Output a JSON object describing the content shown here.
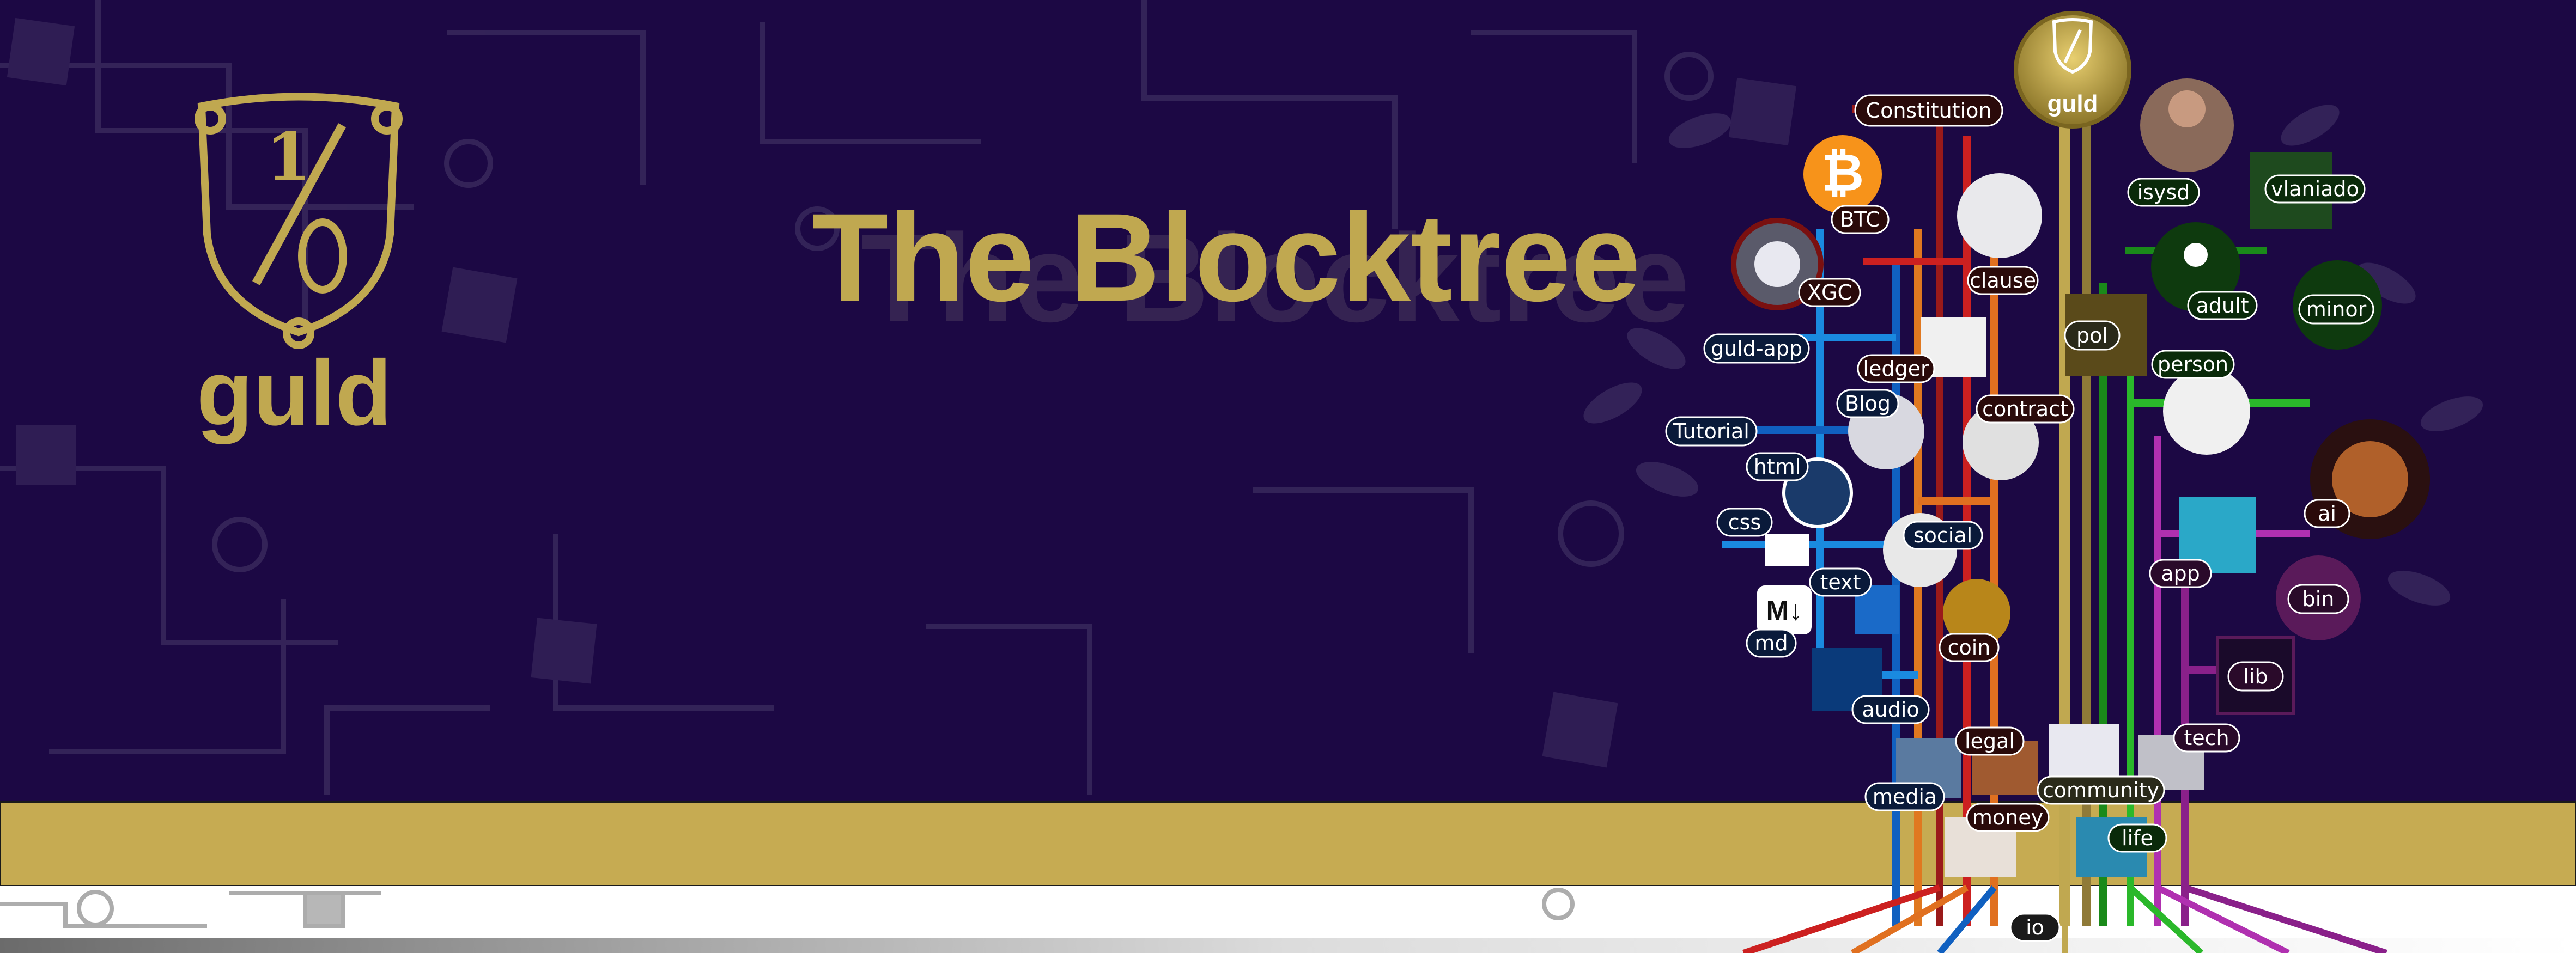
{
  "logo": {
    "text": "guld"
  },
  "title": {
    "text": "The Blocktree"
  },
  "tree": {
    "root_label": "guld",
    "nodes": [
      "Constitution",
      "BTC",
      "XGC",
      "clause",
      "isysd",
      "vlaniado",
      "guld-app",
      "ledger",
      "pol",
      "adult",
      "minor",
      "Blog",
      "contract",
      "person",
      "Tutorial",
      "html",
      "css",
      "social",
      "ai",
      "app",
      "text",
      "bin",
      "md",
      "coin",
      "lib",
      "audio",
      "tech",
      "legal",
      "media",
      "community",
      "money",
      "life",
      "io"
    ]
  },
  "colors": {
    "background": "#1c0844",
    "gold": "#c0a850",
    "band": "#c6ab52",
    "white_strip": "#ffffff"
  }
}
